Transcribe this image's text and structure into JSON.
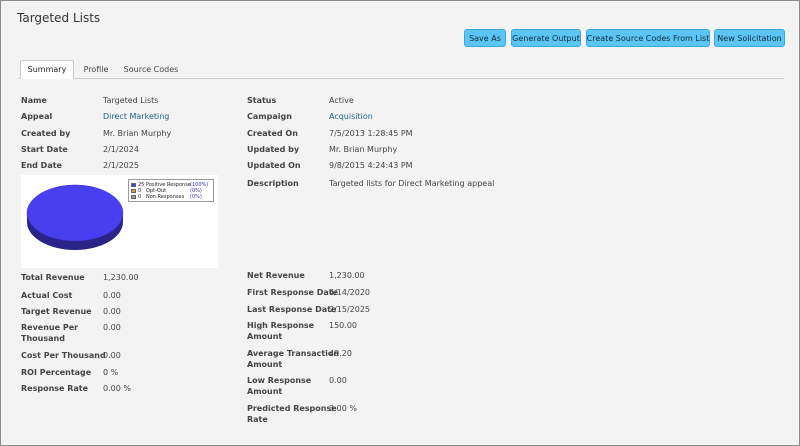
{
  "page": {
    "title": "Targeted Lists"
  },
  "toolbar": {
    "save_as": "Save As",
    "generate_output": "Generate Output",
    "create_source_codes": "Create Source Codes From List",
    "new_solicitation": "New Solicitation"
  },
  "tabs": {
    "summary": "Summary",
    "profile": "Profile",
    "source_codes": "Source Codes"
  },
  "details": {
    "name_label": "Name",
    "name": "Targeted Lists",
    "appeal_label": "Appeal",
    "appeal": "Direct Marketing",
    "created_by_label": "Created by",
    "created_by": "Mr. Brian Murphy",
    "start_date_label": "Start Date",
    "start_date": "2/1/2024",
    "end_date_label": "End Date",
    "end_date": "2/1/2025",
    "status_label": "Status",
    "status": "Active",
    "campaign_label": "Campaign",
    "campaign": "Acquisition",
    "created_on_label": "Created On",
    "created_on": "7/5/2013 1:28:45 PM",
    "updated_by_label": "Updated by",
    "updated_by": "Mr. Brian Murphy",
    "updated_on_label": "Updated On",
    "updated_on": "9/8/2015 4:24:43 PM",
    "description_label": "Description",
    "description": "Targeted lists for Direct Marketing appeal"
  },
  "metrics": {
    "total_revenue_label": "Total Revenue",
    "total_revenue": "1,230.00",
    "actual_cost_label": "Actual Cost",
    "actual_cost": "0.00",
    "target_revenue_label": "Target Revenue",
    "target_revenue": "0.00",
    "revenue_per_thousand_label_1": "Revenue Per",
    "revenue_per_thousand_label_2": "Thousand",
    "revenue_per_thousand": "0.00",
    "cost_per_thousand_label": "Cost Per Thousand",
    "cost_per_thousand": "0.00",
    "roi_label": "ROI Percentage",
    "roi": "0 %",
    "response_rate_label": "Response Rate",
    "response_rate": "0.00 %",
    "net_revenue_label": "Net Revenue",
    "net_revenue": "1,230.00",
    "first_response_label": "First Response Date",
    "first_response": "4/14/2020",
    "last_response_label": "Last Response Date",
    "last_response": "2/15/2025",
    "high_response_label_1": "High Response",
    "high_response_label_2": "Amount",
    "high_response": "150.00",
    "avg_transaction_label_1": "Average Transaction",
    "avg_transaction_label_2": "Amount",
    "avg_transaction": "49.20",
    "low_response_label_1": "Low Response",
    "low_response_label_2": "Amount",
    "low_response": "0.00",
    "predicted_rate_label_1": "Predicted Response",
    "predicted_rate_label_2": "Rate",
    "predicted_rate": "3.00 %"
  },
  "chart_data": {
    "type": "pie",
    "series": [
      {
        "name": "Positive Response",
        "value": 25,
        "percent": "(100%)",
        "color": "#4a3ff0"
      },
      {
        "name": "Opt-Out",
        "value": 0,
        "percent": "(0%)",
        "color": "#d9a23a"
      },
      {
        "name": "Non Responses",
        "value": 0,
        "percent": "(0%)",
        "color": "#9a9a9a"
      }
    ]
  }
}
